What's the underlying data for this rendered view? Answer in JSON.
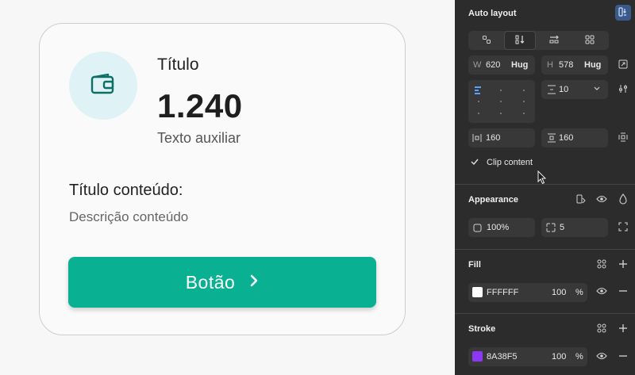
{
  "card": {
    "title": "Título",
    "number": "1.240",
    "aux": "Texto auxiliar",
    "content_title": "Título conteúdo:",
    "content_desc": "Descrição conteúdo",
    "button_label": "Botão",
    "icon": "wallet-icon",
    "accent": "#0ab092",
    "icon_bg": "#dff2f5"
  },
  "panel": {
    "auto_layout": {
      "title": "Auto layout",
      "w_label": "W",
      "w_value": "620",
      "w_mode": "Hug",
      "h_label": "H",
      "h_value": "578",
      "h_mode": "Hug",
      "gap_value": "10",
      "pad_h": "160",
      "pad_v": "160",
      "clip_label": "Clip content",
      "clip_checked": true
    },
    "appearance": {
      "title": "Appearance",
      "opacity": "100%",
      "radius": "5"
    },
    "fill": {
      "title": "Fill",
      "hex": "FFFFFF",
      "opacity": "100",
      "unit": "%",
      "color": "#FFFFFF"
    },
    "stroke": {
      "title": "Stroke",
      "hex": "8A38F5",
      "opacity": "100",
      "unit": "%",
      "color": "#8A38F5"
    }
  }
}
